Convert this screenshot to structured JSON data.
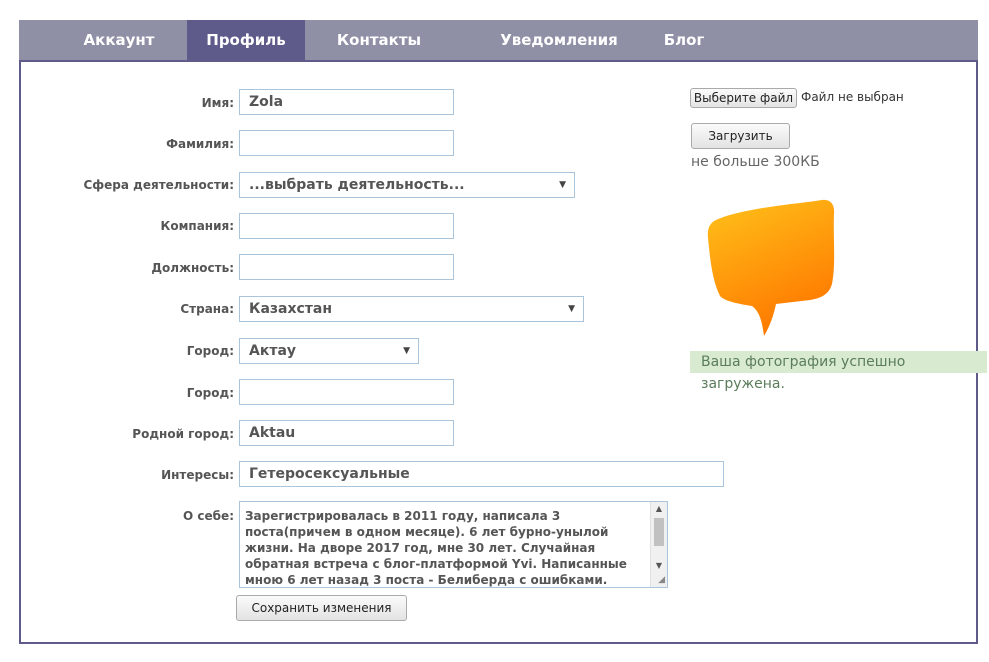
{
  "tabs": [
    {
      "label": "Аккаунт",
      "active": false
    },
    {
      "label": "Профиль",
      "active": true
    },
    {
      "label": "Контакты",
      "active": false
    },
    {
      "label": "Уведомления",
      "active": false
    },
    {
      "label": "Блог",
      "active": false
    }
  ],
  "form": {
    "first_name": {
      "label": "Имя:",
      "value": "Zola"
    },
    "last_name": {
      "label": "Фамилия:",
      "value": ""
    },
    "occupation": {
      "label": "Сфера деятельности:",
      "value": "...выбрать деятельность..."
    },
    "company": {
      "label": "Компания:",
      "value": ""
    },
    "position": {
      "label": "Должность:",
      "value": ""
    },
    "country": {
      "label": "Страна:",
      "value": "Казахстан"
    },
    "city_select": {
      "label": "Город:",
      "value": "Актау"
    },
    "city_text": {
      "label": "Город:",
      "value": ""
    },
    "hometown": {
      "label": "Родной город:",
      "value": "Aktau"
    },
    "interests": {
      "label": "Интересы:",
      "value": "Гетеросексуальные"
    },
    "about": {
      "label": "О себе:",
      "value": "Зарегистрировалась в 2011 году, написала 3 поста(причем в одном месяце).   6 лет  бурно-унылой жизни.  На дворе 2017 год, мне 30 лет. Случайная обратная встреча с блог-платформой Yvi. Написанные мною 6 лет назад 3 поста - Белиберда с ошибками. Читать было Поэтому я их удалила."
    },
    "save_label": "Сохранить изменения"
  },
  "photo": {
    "choose_file_label": "Выберите файл",
    "file_status": "Файл не выбран",
    "upload_label": "Загрузить",
    "size_hint": "не больше 300КБ",
    "success_message": "Ваша фотография успешно загружена.",
    "bubble_color": "#ff9a00"
  },
  "colors": {
    "tab_bar": "#8f90a6",
    "tab_active": "#5e5a8a",
    "input_border": "#aac4dc"
  }
}
